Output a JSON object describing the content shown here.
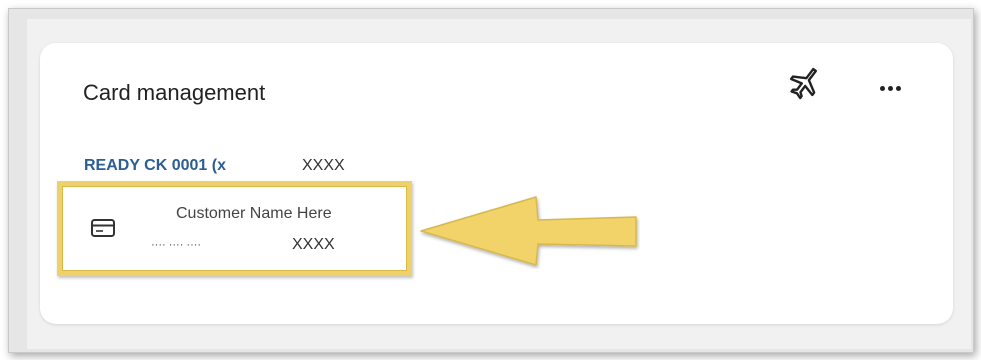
{
  "card_widget": {
    "title": "Card management",
    "account_name": "READY CK 0001 (x",
    "account_mask": "XXXX",
    "card": {
      "customer_name": "Customer Name Here",
      "masked_number": "···· ···· ···· ",
      "number_suffix": "XXXX"
    }
  },
  "icons": {
    "travel": "airplane-icon",
    "more": "more-options-icon",
    "card": "credit-card-icon"
  },
  "colors": {
    "account_link": "#2d5d92",
    "highlight": "#efd16c"
  }
}
